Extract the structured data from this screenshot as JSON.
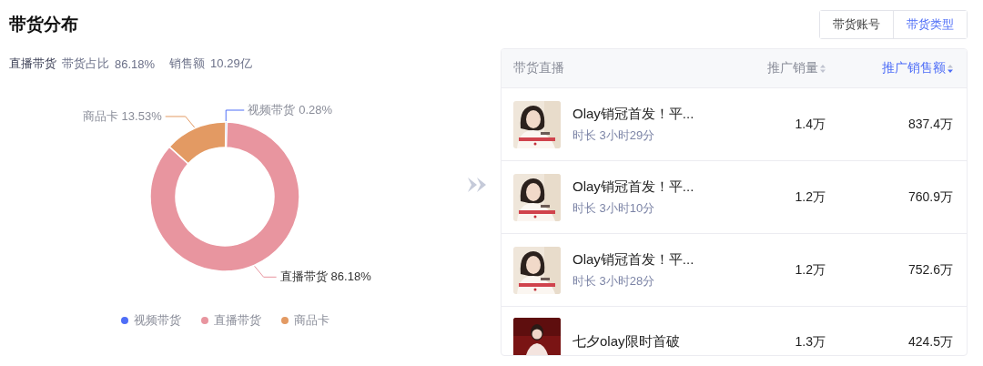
{
  "title": "带货分布",
  "tabs": [
    {
      "label": "带货账号",
      "selected": false
    },
    {
      "label": "带货类型",
      "selected": true
    }
  ],
  "summary": {
    "channel": "直播带货",
    "share_label": "带货占比",
    "share": "86.18%",
    "sales_label": "销售额",
    "sales": "10.29亿"
  },
  "chart_data": {
    "type": "donut",
    "categories": [
      "视频带货",
      "直播带货",
      "商品卡"
    ],
    "values": [
      0.28,
      86.18,
      13.53
    ],
    "value_labels": [
      "0.28%",
      "86.18%",
      "13.53%"
    ]
  },
  "legend": [
    {
      "label": "视频带货",
      "color": "#4f6ef7"
    },
    {
      "label": "直播带货",
      "color": "#e8959f"
    },
    {
      "label": "商品卡",
      "color": "#e39a63"
    }
  ],
  "table": {
    "columns": [
      {
        "label": "带货直播",
        "sortable": false,
        "selected": false
      },
      {
        "label": "推广销量",
        "sortable": true,
        "selected": false
      },
      {
        "label": "推广销售额",
        "sortable": true,
        "selected": true
      }
    ],
    "rows": [
      {
        "title": "Olay销冠首发！平...",
        "duration": "时长 3小时29分",
        "sales_volume": "1.4万",
        "sales_amount": "837.4万"
      },
      {
        "title": "Olay销冠首发！平...",
        "duration": "时长 3小时10分",
        "sales_volume": "1.2万",
        "sales_amount": "760.9万"
      },
      {
        "title": "Olay销冠首发！平...",
        "duration": "时长 3小时28分",
        "sales_volume": "1.2万",
        "sales_amount": "752.6万"
      },
      {
        "title": "七夕olay限时首破",
        "sales_volume": "1.3万",
        "sales_amount": "424.5万"
      }
    ]
  }
}
